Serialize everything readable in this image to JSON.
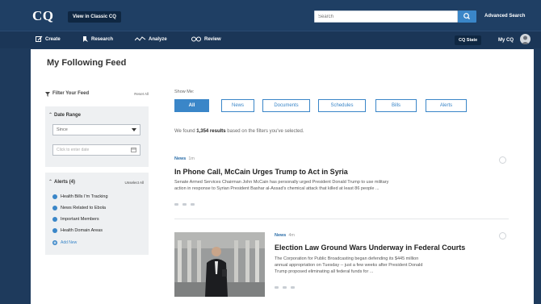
{
  "header": {
    "logo": "CQ",
    "classic_button": "View in Classic CQ",
    "search_placeholder": "Search",
    "advanced_search": "Advanced Search"
  },
  "nav": {
    "items": [
      {
        "label": "Create",
        "icon": "edit-icon"
      },
      {
        "label": "Research",
        "icon": "research-icon"
      },
      {
        "label": "Analyze",
        "icon": "analyze-icon"
      },
      {
        "label": "Review",
        "icon": "review-icon"
      }
    ],
    "cq_state": "CQ State",
    "my_cq": "My CQ"
  },
  "page": {
    "title": "My Following Feed"
  },
  "sidebar": {
    "filter_title": "Filter Your Feed",
    "reset_all": "Reset All",
    "date_range": {
      "title": "Date Range",
      "select_value": "Since",
      "date_placeholder": "Click to enter date"
    },
    "alerts": {
      "title": "Alerts (4)",
      "unselect_all": "Unselect All",
      "items": [
        "Health Bills I'm Tracking",
        "News Related to Ebola",
        "Important Members",
        "Health Domain Areas"
      ],
      "add_new": "Add New"
    }
  },
  "main": {
    "show_me": "Show Me:",
    "filters": [
      "All",
      "News",
      "Documents",
      "Schedules",
      "Bills",
      "Alerts"
    ],
    "active_filter": "All",
    "results_prefix": "We found ",
    "results_count": "1,354 results",
    "results_suffix": " based on the filters you've selected.",
    "articles": [
      {
        "tag": "News",
        "time": "1m",
        "title": "In Phone Call, McCain Urges Trump to Act in Syria",
        "body_1": "Senate Armed Services Chairman John McCain has personally urged President Donald Trump to use military",
        "body_2": "action in response to Syrian President Bashar al-Assad's chemical attack that killed at least 86 people ..."
      },
      {
        "tag": "News",
        "time": "4m",
        "title": "Election Law Ground Wars Underway in Federal Courts",
        "body_1": "The Corporation for Public Broadcasting began defending its $445 million",
        "body_2": "annual appropriation on Tuesday -- just a few weeks after President Donald",
        "body_3": "Trump proposed eliminating all federal funds for ..."
      }
    ]
  },
  "colors": {
    "header_bg": "#1f3f64",
    "accent": "#3a86c8",
    "panel_bg": "#ffffff",
    "sidebar_box": "#eef0f2"
  }
}
